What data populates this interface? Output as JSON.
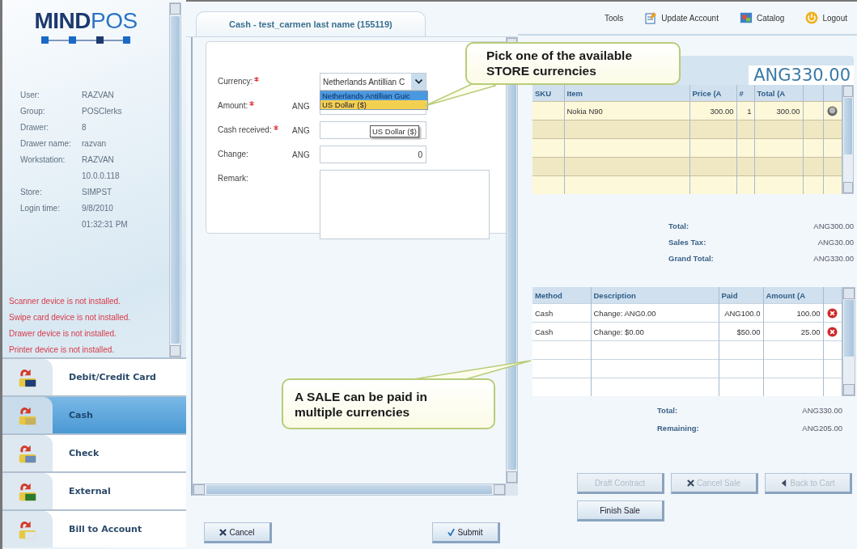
{
  "logo": {
    "bold": "MIND",
    "light": "POS"
  },
  "user_info": [
    {
      "label": "User:",
      "values": [
        "RAZVAN"
      ]
    },
    {
      "label": "Group:",
      "values": [
        "POSClerks"
      ]
    },
    {
      "label": "Drawer:",
      "values": [
        "8"
      ]
    },
    {
      "label": "Drawer name:",
      "values": [
        "razvan"
      ]
    },
    {
      "label": "Workstation:",
      "values": [
        "RAZVAN",
        "10.0.0.118"
      ]
    },
    {
      "label": "Store:",
      "values": [
        "SIMPST"
      ]
    },
    {
      "label": "Login time:",
      "values": [
        "9/8/2010",
        "01:32:31 PM"
      ]
    }
  ],
  "device_messages": [
    "Scanner device is not installed.",
    "Swipe card device is not installed.",
    "Drawer device is not installed.",
    "Printer device is not installed."
  ],
  "payment_methods": [
    {
      "label": "Debit/Credit Card",
      "selected": false
    },
    {
      "label": "Cash",
      "selected": true
    },
    {
      "label": "Check",
      "selected": false
    },
    {
      "label": "External",
      "selected": false
    },
    {
      "label": "Bill to Account",
      "selected": false
    }
  ],
  "payment_form": {
    "title": "Cash - test_carmen last name (155119)",
    "fields": [
      {
        "kind": "select",
        "label": "Currency:",
        "required": true,
        "value": "Netherlands Antillian C"
      },
      {
        "kind": "input",
        "label": "Amount:",
        "required": true,
        "unit": "ANG"
      },
      {
        "kind": "input",
        "label": "Cash received:",
        "required": true,
        "unit": "ANG"
      },
      {
        "kind": "input",
        "label": "Change:",
        "required": false,
        "unit": "ANG",
        "value": "0"
      },
      {
        "kind": "textarea",
        "label": "Remark:",
        "required": false
      }
    ],
    "currency_options": [
      {
        "label": "Netherlands Antillian Guic",
        "selected": true,
        "hovered": false
      },
      {
        "label": "US Dollar ($)",
        "selected": false,
        "hovered": true
      }
    ],
    "tooltip": "US Dollar ($)",
    "buttons": [
      {
        "label": "Cancel"
      },
      {
        "label": "Submit"
      }
    ]
  },
  "top_menu": [
    {
      "label": "Tools"
    },
    {
      "label": "Update Account"
    },
    {
      "label": "Catalog"
    },
    {
      "label": "Logout"
    }
  ],
  "cart": {
    "total_display": "ANG330.00",
    "columns": [
      "SKU",
      "Item",
      "Price (A",
      "#",
      "Total (A"
    ],
    "rows": [
      {
        "cells": [
          "",
          "Nokia N90",
          "300.00",
          "1",
          "300.00"
        ]
      }
    ],
    "summary": [
      {
        "label": "Total:",
        "value": "ANG300.00"
      },
      {
        "label": "Sales Tax:",
        "value": "ANG30.00"
      },
      {
        "label": "Grand Total:",
        "value": "ANG330.00"
      }
    ]
  },
  "payments": {
    "columns": [
      "Method",
      "Description",
      "Paid",
      "Amount (A"
    ],
    "rows": [
      {
        "cells": [
          "Cash",
          "Change: ANG0.00",
          "ANG100.0",
          "100.00"
        ]
      },
      {
        "cells": [
          "Cash",
          "Change: $0.00",
          "$50.00",
          "25.00"
        ]
      }
    ],
    "summary": [
      {
        "label": "Total:",
        "value": "ANG330.00"
      },
      {
        "label": "Remaining:",
        "value": "ANG205.00"
      }
    ]
  },
  "actions": [
    {
      "label": "Draft Contract",
      "disabled": true
    },
    {
      "label": "Cancel Sale",
      "disabled": true
    },
    {
      "label": "Back to Cart",
      "disabled": true
    },
    {
      "label": "Finish Sale",
      "disabled": false
    }
  ],
  "callouts": [
    {
      "text": "Pick one of the available STORE currencies"
    },
    {
      "text": "A SALE can be paid in multiple currencies"
    }
  ]
}
